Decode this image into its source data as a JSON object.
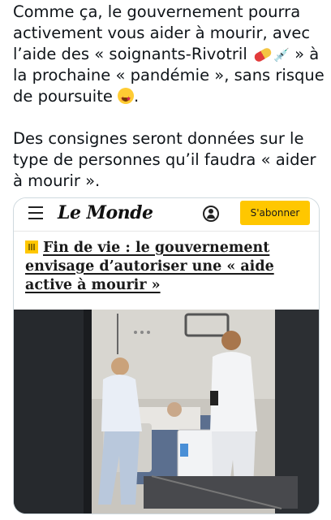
{
  "tweet": {
    "para1_part1": "Comme ça, le gouvernement pourra activement vous aider à mourir, avec l’aide des « soignants-Rivotril ",
    "pill_emoji": "pill-emoji",
    "syringe_emoji": "💉",
    "para1_part2": " » à la prochaine « pandémie », sans risque de poursuite ",
    "star_face_emoji": "star-struck-emoji",
    "para1_part3": ".",
    "para2": "Des consignes seront données sur le type de personnes qu’il faudra « aider à mourir »."
  },
  "article": {
    "site_logo": "Le Monde",
    "subscribe_label": "S'abonner",
    "headline": "Fin de vie : le gouvernement envisage d’autoriser une « aide active à mourir »",
    "icons": {
      "menu": "hamburger-menu-icon",
      "account": "account-icon",
      "premium": "premium-article-icon"
    },
    "image_alt": "hospital-room-photo"
  },
  "colors": {
    "subscribe_bg": "#ffc700",
    "text": "#0f1419",
    "card_border": "#cfd9de"
  }
}
